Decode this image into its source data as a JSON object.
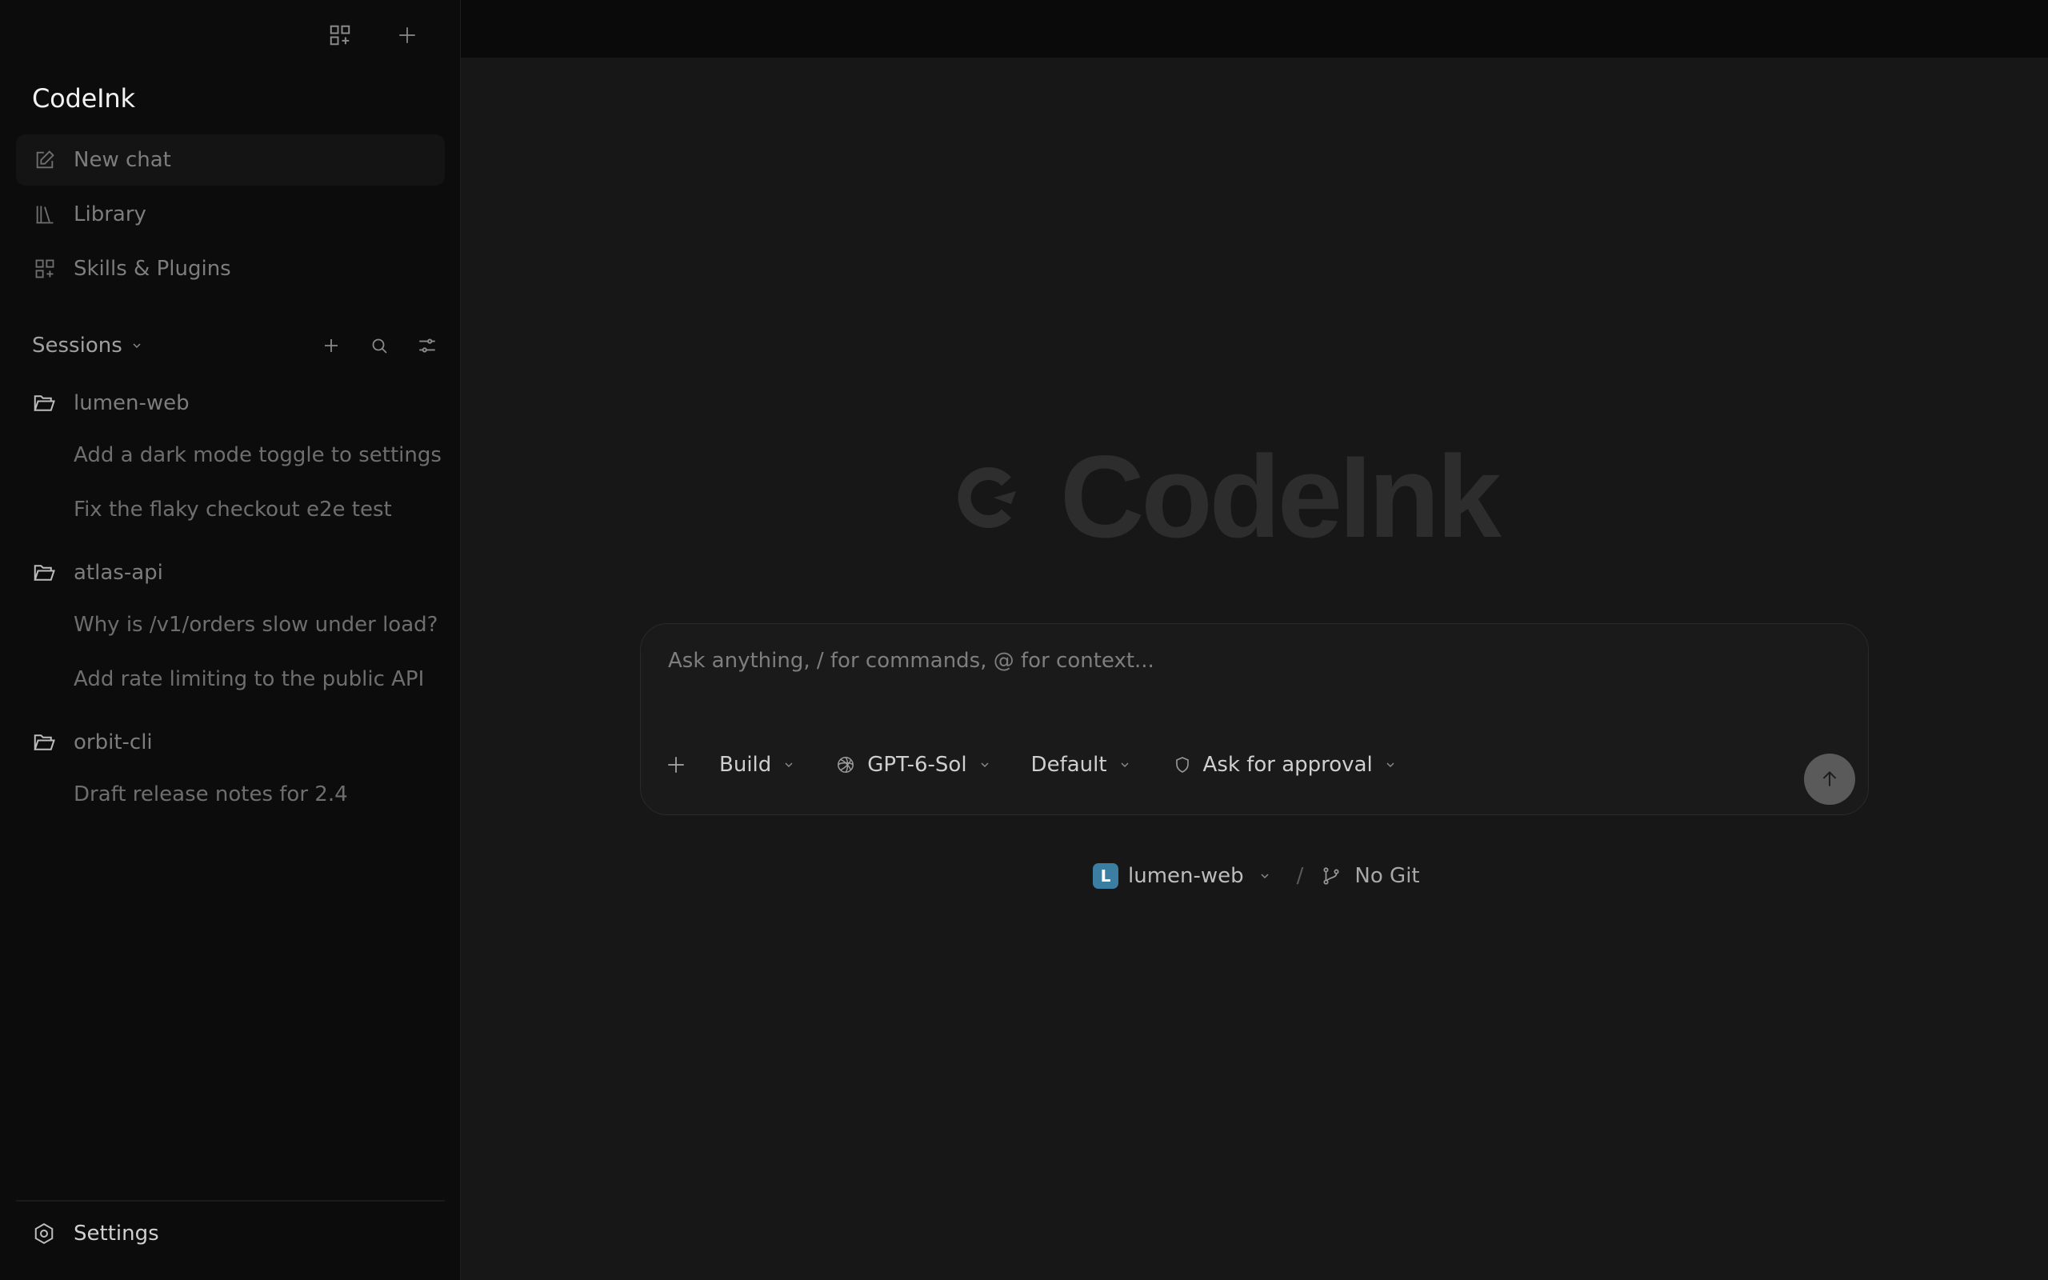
{
  "app": {
    "name": "CodeInk"
  },
  "nav": {
    "new_chat": "New chat",
    "library": "Library",
    "skills": "Skills & Plugins"
  },
  "sessions": {
    "title": "Sessions",
    "projects": [
      {
        "name": "lumen-web",
        "items": [
          "Add a dark mode toggle to settings",
          "Fix the flaky checkout e2e test"
        ]
      },
      {
        "name": "atlas-api",
        "items": [
          "Why is /v1/orders slow under load?",
          "Add rate limiting to the public API"
        ]
      },
      {
        "name": "orbit-cli",
        "items": [
          "Draft release notes for 2.4"
        ]
      }
    ]
  },
  "settings": {
    "label": "Settings"
  },
  "main": {
    "logo_text": "CodeInk",
    "composer": {
      "placeholder": "Ask anything, / for commands, @ for context...",
      "mode": "Build",
      "model": "GPT-6-Sol",
      "profile": "Default",
      "approval": "Ask for approval"
    },
    "context": {
      "project_initial": "L",
      "project": "lumen-web",
      "separator": "/",
      "git": "No Git"
    }
  },
  "colors": {
    "sidebar_bg": "#0c0c0c",
    "main_bg": "#171717",
    "topbar_bg": "#0a0a0a",
    "project_badge": "#3b7ea1",
    "send_button": "#5a5a5a"
  }
}
